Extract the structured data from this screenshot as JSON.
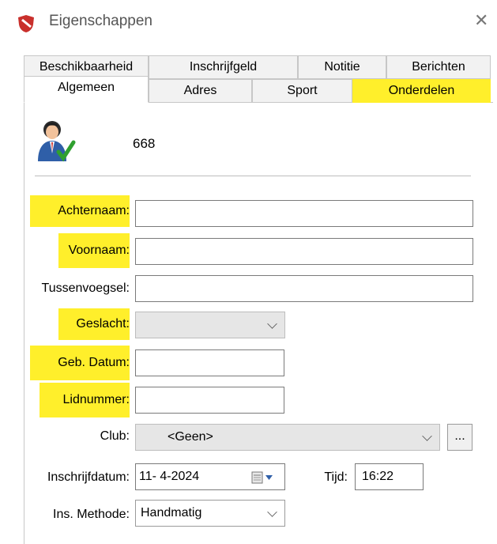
{
  "window": {
    "title": "Eigenschappen",
    "close_glyph": "✕",
    "app_icon": "shield-icon"
  },
  "tabs": {
    "row_top": [
      "Beschikbaarheid",
      "Inschrijfgeld",
      "Notitie",
      "Berichten"
    ],
    "row_bottom": [
      "Algemeen",
      "Adres",
      "Sport",
      "Onderdelen"
    ],
    "active": "Algemeen",
    "highlighted": "Onderdelen"
  },
  "member": {
    "id": "668",
    "avatar_icon": "person-check-icon"
  },
  "form": {
    "achternaam": {
      "label": "Achternaam:",
      "value": ""
    },
    "voornaam": {
      "label": "Voornaam:",
      "value": ""
    },
    "tussenvoegsel": {
      "label": "Tussenvoegsel:",
      "value": ""
    },
    "geslacht": {
      "label": "Geslacht:",
      "value": ""
    },
    "geb_datum": {
      "label": "Geb. Datum:",
      "value": ""
    },
    "lidnummer": {
      "label": "Lidnummer:",
      "value": ""
    },
    "club": {
      "label": "Club:",
      "value": "<Geen>",
      "more_label": "..."
    },
    "inschrijfdatum": {
      "label": "Inschrijfdatum:",
      "value": "11- 4-2024"
    },
    "tijd": {
      "label": "Tijd:",
      "value": "16:22"
    },
    "ins_methode": {
      "label": "Ins. Methode:",
      "value": "Handmatig"
    }
  },
  "colors": {
    "highlight": "#ffef2b",
    "accent_red": "#c9302c"
  }
}
